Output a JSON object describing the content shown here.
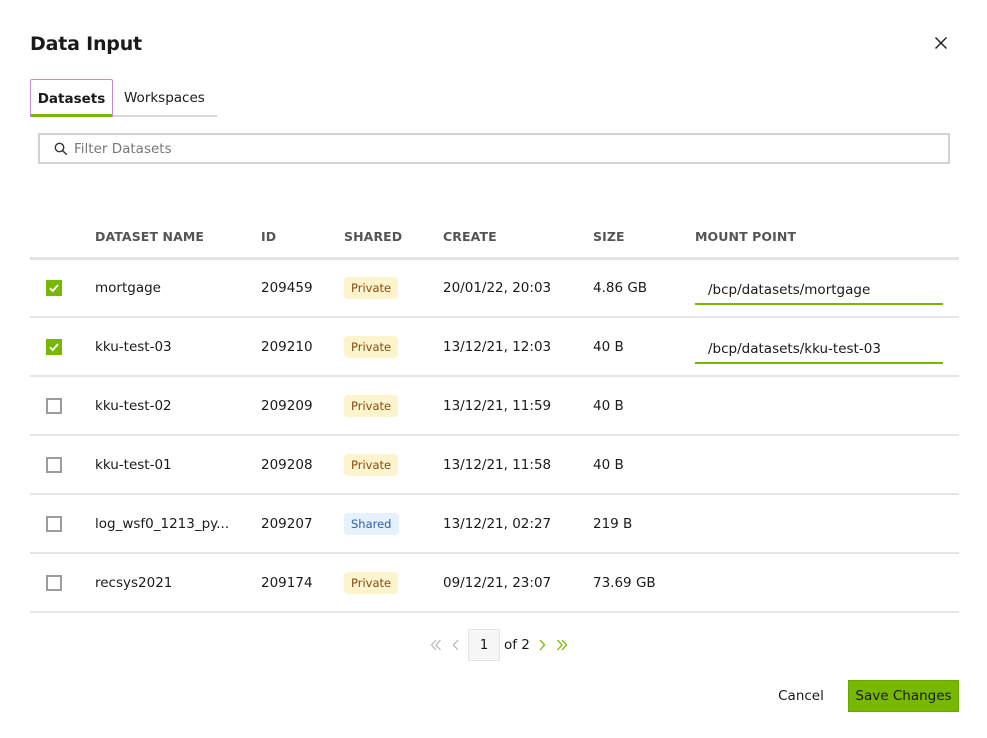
{
  "dialog": {
    "title": "Data Input",
    "close_icon": "close-icon"
  },
  "tabs": [
    {
      "label": "Datasets",
      "active": true
    },
    {
      "label": "Workspaces",
      "active": false
    }
  ],
  "search": {
    "placeholder": "Filter Datasets",
    "value": "",
    "icon": "search-icon"
  },
  "table": {
    "columns": [
      "",
      "DATASET NAME",
      "ID",
      "SHARED",
      "CREATE",
      "SIZE",
      "MOUNT POINT"
    ],
    "rows": [
      {
        "checked": true,
        "name": "mortgage",
        "id": "209459",
        "shared": "Private",
        "create": "20/01/22, 20:03",
        "size": "4.86 GB",
        "mount_point": "/bcp/datasets/mortgage"
      },
      {
        "checked": true,
        "name": "kku-test-03",
        "id": "209210",
        "shared": "Private",
        "create": "13/12/21, 12:03",
        "size": "40 B",
        "mount_point": "/bcp/datasets/kku-test-03"
      },
      {
        "checked": false,
        "name": "kku-test-02",
        "id": "209209",
        "shared": "Private",
        "create": "13/12/21, 11:59",
        "size": "40 B",
        "mount_point": null
      },
      {
        "checked": false,
        "name": "kku-test-01",
        "id": "209208",
        "shared": "Private",
        "create": "13/12/21, 11:58",
        "size": "40 B",
        "mount_point": null
      },
      {
        "checked": false,
        "name": "log_wsf0_1213_py...",
        "id": "209207",
        "shared": "Shared",
        "create": "13/12/21, 02:27",
        "size": "219 B",
        "mount_point": null
      },
      {
        "checked": false,
        "name": "recsys2021",
        "id": "209174",
        "shared": "Private",
        "create": "09/12/21, 23:07",
        "size": "73.69 GB",
        "mount_point": null
      }
    ]
  },
  "pagination": {
    "current_page": "1",
    "of_label": "of 2",
    "total_pages": 2
  },
  "footer": {
    "cancel_label": "Cancel",
    "save_label": "Save Changes"
  },
  "colors": {
    "accent": "#76b900",
    "private_badge_bg": "#fcf4cc",
    "private_badge_text": "#8a4a12",
    "shared_badge_bg": "#e5f1fc",
    "shared_badge_text": "#2f5fa8"
  }
}
